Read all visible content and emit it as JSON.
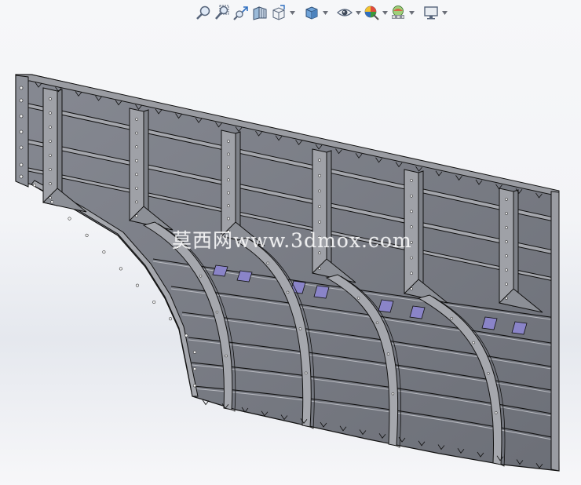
{
  "toolbar": {
    "icons": [
      "zoom-to-fit-icon",
      "zoom-to-area-icon",
      "previous-view-icon",
      "section-view-icon",
      "view-orientation-icon",
      "display-style-icon",
      "hide-show-items-icon",
      "edit-appearance-icon",
      "apply-scene-icon",
      "view-settings-icon"
    ],
    "colors": {
      "blue": "#2f6fc0",
      "green": "#3a9a3a",
      "red": "#d23a2a",
      "gray": "#6b6f78"
    }
  },
  "model": {
    "name": "curved-steel-formwork-panel",
    "colors": {
      "plate": "#7d8088",
      "plate_dark": "#5f6168",
      "edge": "#111111",
      "rib": "#9a9ca2",
      "accent": "#8a84c8"
    }
  },
  "watermark": {
    "text": "莫西网www.3dmox.com"
  }
}
